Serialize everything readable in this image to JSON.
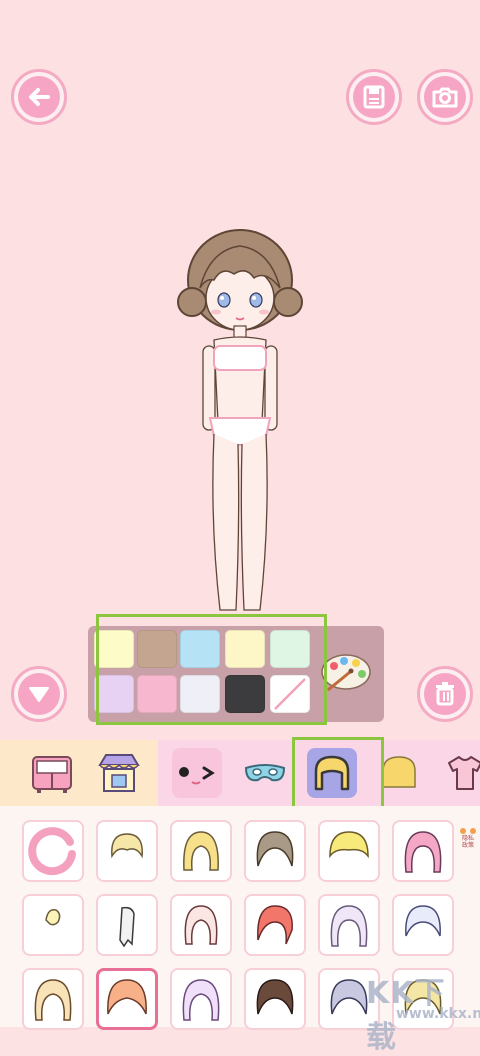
{
  "colors": {
    "background": "#fde0e2",
    "accent": "#f6a6c4",
    "highlight": "#8cc63f",
    "palette_panel": "#c7a0a8"
  },
  "toolbar": {
    "back_icon": "arrow-left-icon",
    "save_icon": "floppy-disk-icon",
    "camera_icon": "camera-icon",
    "collapse_icon": "triangle-down-icon",
    "delete_icon": "trash-icon"
  },
  "palette": {
    "swatches": [
      "#fdfbc8",
      "#c4a58f",
      "#b5e2f5",
      "#fdf6c6",
      "#dff6e5",
      "#e8d2f3",
      "#f7b8cf",
      "#eeeff7",
      "#3c3c3e",
      "none"
    ],
    "paint_icon": "paint-palette-icon"
  },
  "tabs": {
    "items": [
      "wardrobe-icon",
      "shop-icon",
      "face-icon",
      "mask-icon",
      "hair-front-icon",
      "hair-back-icon",
      "shirt-icon"
    ],
    "active": "hair-front-icon"
  },
  "hair_grid": {
    "items": [
      "reset-icon",
      "hair-1",
      "hair-2",
      "hair-3",
      "hair-4",
      "hair-5",
      "hair-6",
      "hair-7",
      "hair-8",
      "hair-9",
      "hair-10",
      "hair-11",
      "hair-12",
      "hair-13",
      "hair-14",
      "hair-15",
      "hair-16",
      "hair-17"
    ],
    "selected": "hair-13"
  },
  "badge": {
    "text": "隐私\n政策"
  },
  "watermark": {
    "main": "KK下载",
    "url": "www.kkx.net"
  }
}
